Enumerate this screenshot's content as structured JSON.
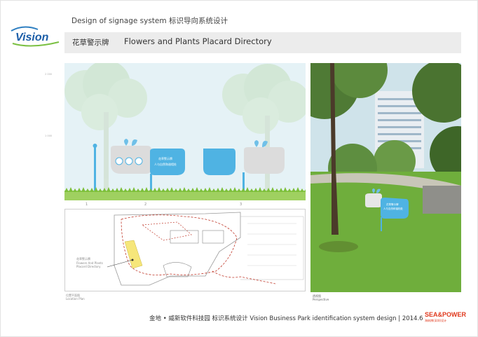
{
  "header": {
    "title": "Design of signage system  标识导向系统设计"
  },
  "logo": {
    "text": "Vision"
  },
  "title_bar": {
    "cn": "花草警示牌",
    "en": "Flowers and Plants Placard Directory"
  },
  "elevation": {
    "ruler_labels": [
      "1 000",
      "2 000"
    ],
    "views": [
      "1",
      "2",
      "3"
    ],
    "sign_text": [
      "花草警示牌",
      "人与自然和谐相处"
    ]
  },
  "plan": {
    "callout": [
      "花草警示牌",
      "Flowers And Plants",
      "Placard Directory"
    ],
    "location_label": [
      "位置平面图",
      "Location Plan"
    ]
  },
  "photo": {
    "sign_text": [
      "花草警示牌",
      "人与自然和谐相处"
    ],
    "label": [
      "透视图",
      "Perspective"
    ]
  },
  "footer": {
    "text": "金地 • 威新软件科技园 标识系统设计   Vision Business Park  identification system design | 2014.6"
  },
  "brand": {
    "name": "SEA&POWER",
    "sub": "海纳博(深圳)设计"
  },
  "colors": {
    "accent": "#4fb3e3",
    "grass": "#8cc63f",
    "brand": "#e03a1e"
  }
}
